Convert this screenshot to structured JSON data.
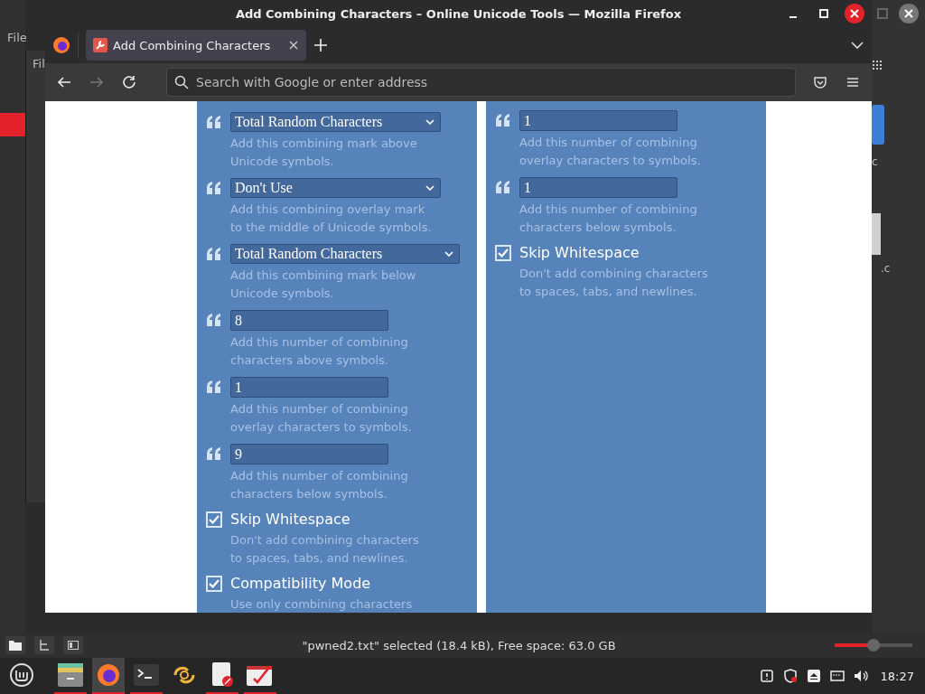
{
  "background_windows": {
    "menu_labels": [
      "File",
      "Fil"
    ],
    "file_labels": [
      "c",
      ".c"
    ]
  },
  "window": {
    "title": "Add Combining Characters – Online Unicode Tools — Mozilla Firefox"
  },
  "tabs": [
    {
      "label": "Add Combining Characters",
      "selected": true
    }
  ],
  "address_bar": {
    "placeholder": "Search with Google or enter address"
  },
  "page": {
    "columns": [
      {
        "options": [
          {
            "kind": "select",
            "value": "Total Random Characters",
            "description": "Add this combining mark above\nUnicode symbols."
          },
          {
            "kind": "select",
            "value": "Don't Use",
            "description": "Add this combining overlay mark\nto the middle of Unicode symbols."
          },
          {
            "kind": "select",
            "value": "Total Random Characters",
            "description": "Add this combining mark below\nUnicode symbols.",
            "wide": true
          },
          {
            "kind": "number",
            "value": "8",
            "description": "Add this number of combining\ncharacters above symbols."
          },
          {
            "kind": "number",
            "value": "1",
            "description": "Add this number of combining\noverlay characters to symbols."
          },
          {
            "kind": "number",
            "value": "9",
            "description": "Add this number of combining\ncharacters below symbols."
          },
          {
            "kind": "checkbox",
            "label": "Skip Whitespace",
            "checked": true,
            "description": "Don't add combining characters\nto spaces, tabs, and newlines."
          },
          {
            "kind": "checkbox",
            "label": "Compatibility Mode",
            "checked": true,
            "description": "Use only combining characters"
          }
        ]
      },
      {
        "options": [
          {
            "kind": "number",
            "value": "1",
            "description": "Add this number of combining\noverlay characters to symbols."
          },
          {
            "kind": "number",
            "value": "1",
            "description": "Add this number of combining\ncharacters below symbols."
          },
          {
            "kind": "checkbox",
            "label": "Skip Whitespace",
            "checked": true,
            "description": "Don't add combining characters\nto spaces, tabs, and newlines."
          }
        ]
      }
    ]
  },
  "file_manager_status": {
    "text": "\"pwned2.txt\" selected (18.4 kB), Free space: 63.0 GB",
    "zoom": {
      "level": 0.5
    }
  },
  "taskbar": {
    "clock": "18:27"
  }
}
